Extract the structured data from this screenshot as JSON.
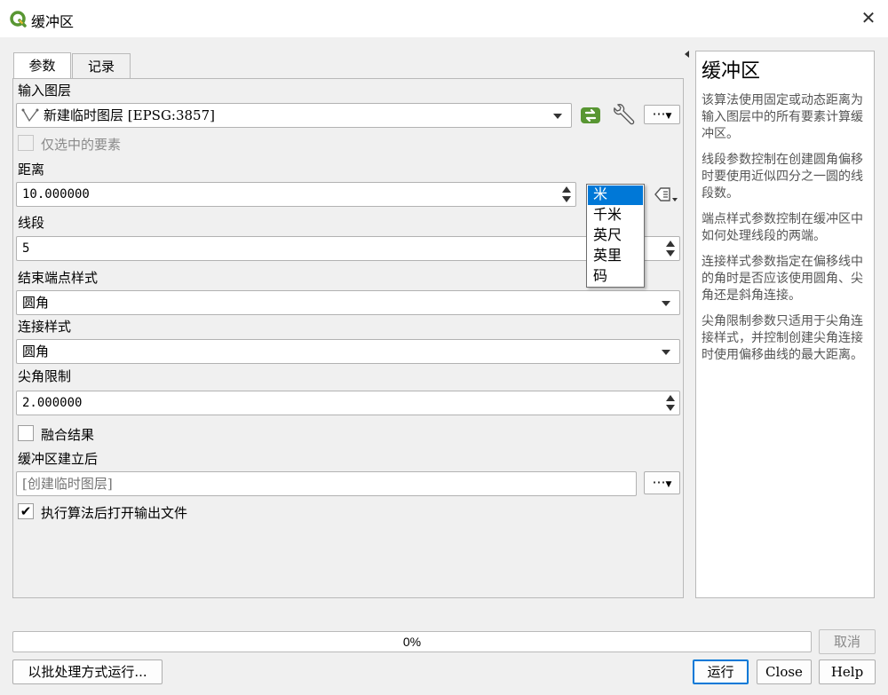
{
  "window": {
    "title": "缓冲区"
  },
  "tabs": [
    {
      "label": "参数"
    },
    {
      "label": "记录"
    }
  ],
  "params": {
    "input_layer": {
      "label": "输入图层",
      "value": "新建临时图层 [EPSG:3857]",
      "more_label": "⋯"
    },
    "selected_only": {
      "label": "仅选中的要素",
      "checked": false,
      "enabled": false
    },
    "distance": {
      "label": "距离",
      "value": "10.000000"
    },
    "units": {
      "options": [
        "米",
        "千米",
        "英尺",
        "英里",
        "码"
      ],
      "selected": "米"
    },
    "segments": {
      "label": "线段",
      "value": "5"
    },
    "end_cap_style": {
      "label": "结束端点样式",
      "value": "圆角"
    },
    "join_style": {
      "label": "连接样式",
      "value": "圆角"
    },
    "miter_limit": {
      "label": "尖角限制",
      "value": "2.000000"
    },
    "dissolve": {
      "label": "融合结果",
      "checked": false
    },
    "output": {
      "label": "缓冲区建立后",
      "placeholder": "[创建临时图层]",
      "more_label": "⋯"
    },
    "open_output": {
      "label": "执行算法后打开输出文件",
      "checked": true
    }
  },
  "help": {
    "title": "缓冲区",
    "paragraphs": [
      "该算法使用固定或动态距离为输入图层中的所有要素计算缓冲区。",
      "线段参数控制在创建圆角偏移时要使用近似四分之一圆的线段数。",
      "端点样式参数控制在缓冲区中如何处理线段的两端。",
      "连接样式参数指定在偏移线中的角时是否应该使用圆角、尖角还是斜角连接。",
      "尖角限制参数只适用于尖角连接样式，并控制创建尖角连接时使用偏移曲线的最大距离。"
    ]
  },
  "progress": {
    "value": 0,
    "text": "0%"
  },
  "buttons": {
    "cancel": "取消",
    "batch": "以批处理方式运行...",
    "run": "运行",
    "close": "Close",
    "help": "Help"
  },
  "colors": {
    "accent": "#0078d7",
    "qgis_green": "#589632",
    "qgis_yellow": "#eebc2f"
  },
  "icons": [
    "qgis-logo-icon",
    "line-layer-icon",
    "iterate-icon",
    "wrench-icon",
    "data-defined-icon",
    "close-icon",
    "help-collapse-icon"
  ]
}
